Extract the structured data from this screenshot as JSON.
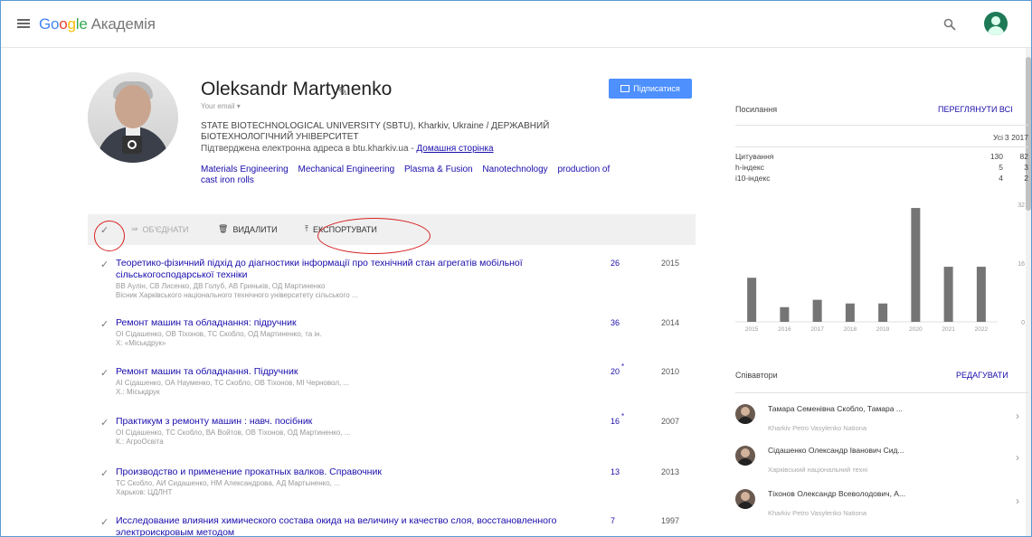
{
  "header": {
    "logo_letters": [
      "Go",
      "o",
      "g",
      "le"
    ],
    "product": "Академія",
    "menu_icon": "hamburger-menu-icon",
    "search_icon": "search-icon",
    "avatar_icon": "account-avatar-icon"
  },
  "profile": {
    "name": "Oleksandr Martynenko",
    "follow_label": "Підписатися",
    "small_link": "Your email ▾",
    "affiliation": "STATE BIOTECHNOLOGICAL UNIVERSITY (SBTU), Kharkiv, Ukraine / ДЕРЖАВНИЙ БІОТЕХНОЛОГІЧНИЙ УНІВЕРСИТЕТ",
    "verified_text": "Підтверджена електронна адреса в btu.kharkiv.ua - ",
    "homepage_label": "Домашня сторінка",
    "interests": [
      "Materials Engineering",
      "Mechanical Engineering",
      "Plasma & Fusion",
      "Nanotechnology",
      "production of cast iron rolls"
    ]
  },
  "toolbar": {
    "merge_label": "ОБ'ЄДНАТИ",
    "delete_label": "ВИДАЛИТИ",
    "export_label": "ЕКСПОРТУВАТИ"
  },
  "articles": [
    {
      "title": "Теоретико-фізичний підхід до діагностики інформації про технічний стан агрегатів мобільної сільськогосподарської техніки",
      "authors": "ВВ Аулін, СВ Лисенко, ДВ Голуб, АВ Гриньків, ОД Мартиненко",
      "venue": "Вісник Харківського національного технічного університету сільського ...",
      "cites": "26",
      "star": "",
      "year": "2015"
    },
    {
      "title": "Ремонт машин та обладнання: підручник",
      "authors": "ОІ Сідашенко, ОВ Тіхонов, ТС Скобло, ОД Мартиненко, та ін.",
      "venue": "Х: «Міськдрук»",
      "cites": "36",
      "star": "",
      "year": "2014"
    },
    {
      "title": "Ремонт машин та обладнання. Підручник",
      "authors": "АІ Сідашенко, ОА Науменко, ТС Скобло, ОВ Тіхонов, МІ Черновол, ...",
      "venue": "Х.: Міськдрук",
      "cites": "20",
      "star": "*",
      "year": "2010"
    },
    {
      "title": "Практикум з ремонту машин : навч. посібник",
      "authors": "ОІ Сідашенко, ТС Скобло, ВА Войтов, ОВ Тіхонов, ОД Мартиненко, ...",
      "venue": "К.: АгроОсвіта",
      "cites": "16",
      "star": "*",
      "year": "2007"
    },
    {
      "title": "Производство и применение прокатных валков. Справочник",
      "authors": "ТС Скобло, АИ Сидашенко, НМ Александрова, АД Мартыненко, ...",
      "venue": "Харьков: ЦДЛНТ",
      "cites": "13",
      "star": "",
      "year": "2013"
    },
    {
      "title": "Исследование влияния химического состава окида на величину и качество слоя, восстановленного электроискровым методом",
      "authors": "",
      "venue": "",
      "cites": "7",
      "star": "",
      "year": "1997"
    }
  ],
  "citations": {
    "title": "Посилання",
    "view_all": "ПЕРЕГЛЯНУТИ ВСІ",
    "col_all": "Усі",
    "col_since": "З 2017",
    "rows": [
      {
        "label": "Цитування",
        "all": "130",
        "since": "82"
      },
      {
        "label": "h-індекс",
        "all": "5",
        "since": "3"
      },
      {
        "label": "i10-індекс",
        "all": "4",
        "since": "2"
      }
    ]
  },
  "chart_data": {
    "type": "bar",
    "categories": [
      "2015",
      "2016",
      "2017",
      "2018",
      "2019",
      "2020",
      "2021",
      "2022"
    ],
    "values": [
      12,
      4,
      6,
      5,
      5,
      31,
      15,
      15
    ],
    "ylim": [
      0,
      32
    ],
    "yticks": [
      "32",
      "16",
      "0"
    ]
  },
  "coauthors": {
    "title": "Співавтори",
    "edit_label": "РЕДАГУВАТИ",
    "items": [
      {
        "name": "Тамара Семенівна Скобло, Тамара ...",
        "affiliation": "Kharkiv Petro Vasylenko Nationa"
      },
      {
        "name": "Сідашенко Олександр Іванович Сид...",
        "affiliation": "Харківський національний техні"
      },
      {
        "name": "Тіхонов Олександр Всеволодович, А...",
        "affiliation": "Kharkiv Petro Vasylenko Nationa"
      }
    ]
  },
  "colors": {
    "accent": "#4d90fe",
    "link": "#1a0dab",
    "bar": "#757575",
    "annotation": "#d62222"
  }
}
